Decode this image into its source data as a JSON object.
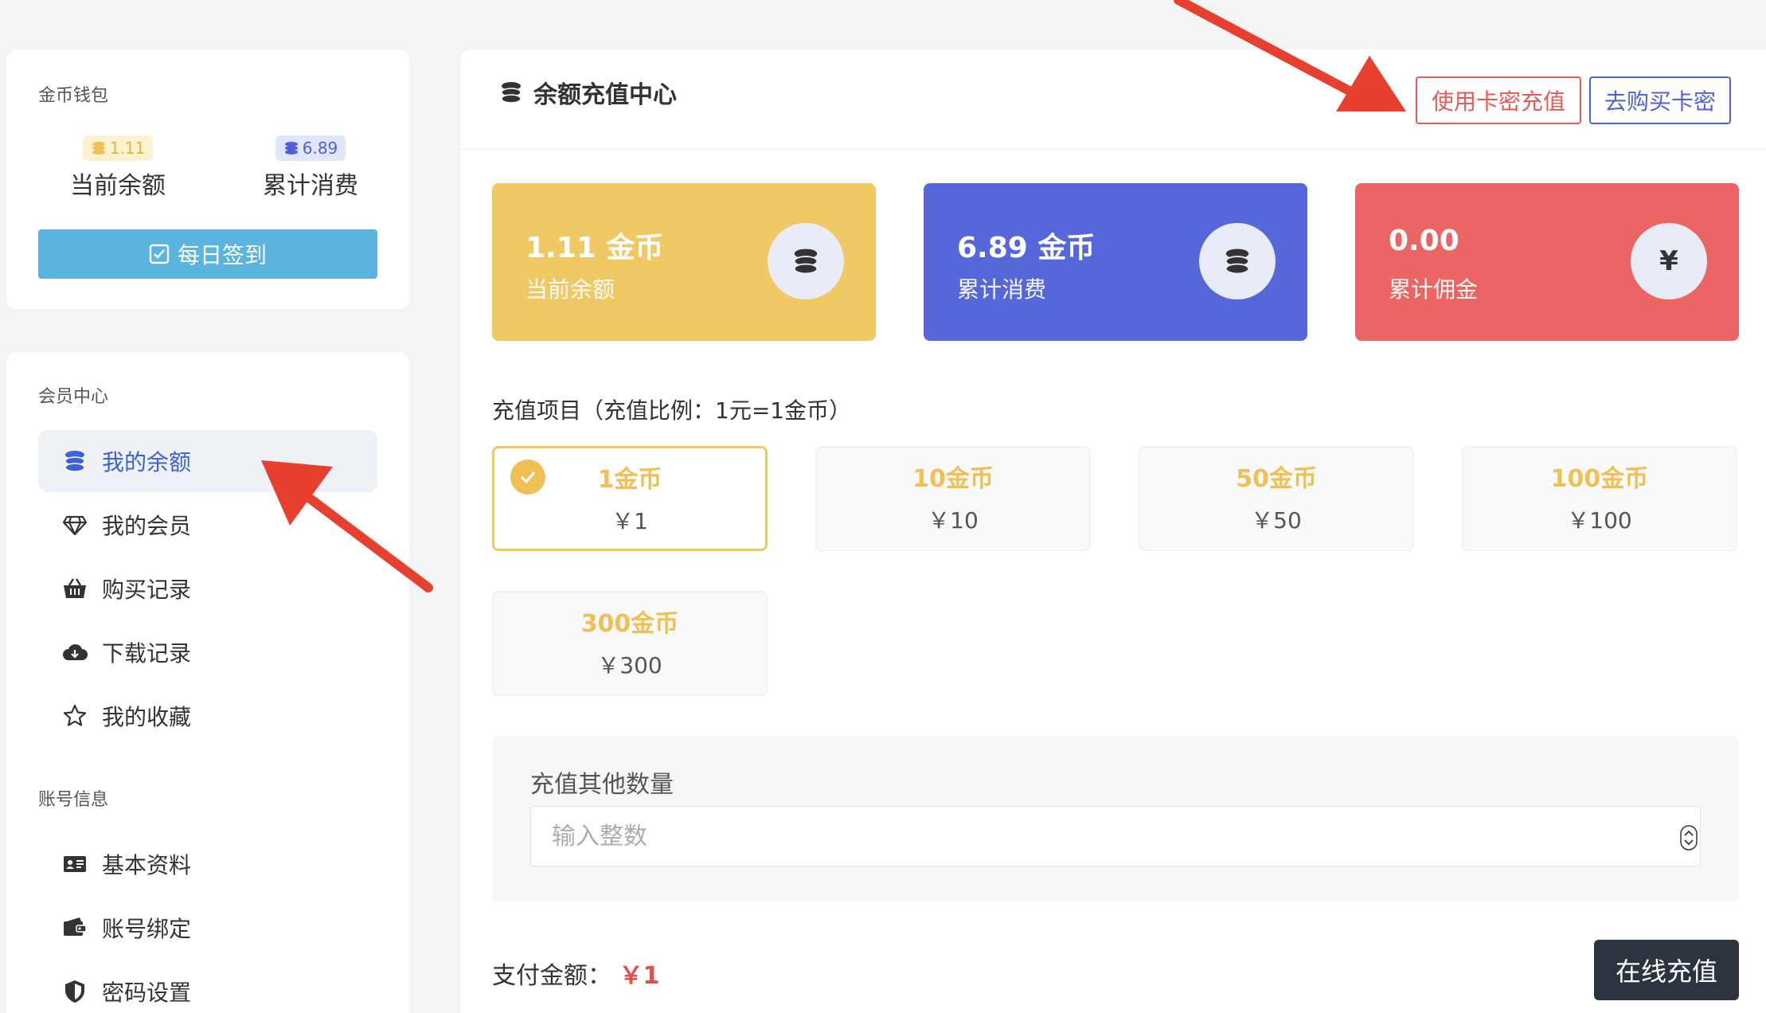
{
  "wallet": {
    "title": "金币钱包",
    "balance_value": "1.11",
    "balance_label": "当前余额",
    "spent_value": "6.89",
    "spent_label": "累计消费",
    "checkin_label": "每日签到"
  },
  "member_center": {
    "title": "会员中心",
    "items": [
      {
        "label": "我的余额",
        "icon": "coins-icon"
      },
      {
        "label": "我的会员",
        "icon": "diamond-icon"
      },
      {
        "label": "购买记录",
        "icon": "basket-icon"
      },
      {
        "label": "下载记录",
        "icon": "cloud-download-icon"
      },
      {
        "label": "我的收藏",
        "icon": "star-icon"
      }
    ]
  },
  "account_info": {
    "title": "账号信息",
    "items": [
      {
        "label": "基本资料",
        "icon": "id-card-icon"
      },
      {
        "label": "账号绑定",
        "icon": "wallet-bind-icon"
      },
      {
        "label": "密码设置",
        "icon": "shield-icon"
      }
    ]
  },
  "main": {
    "title": "余额充值中心",
    "use_card_label": "使用卡密充值",
    "buy_card_label": "去购买卡密",
    "stats": [
      {
        "value": "1.11 金币",
        "label": "当前余额",
        "icon": "coins-icon"
      },
      {
        "value": "6.89 金币",
        "label": "累计消费",
        "icon": "coins-icon"
      },
      {
        "value": "0.00",
        "label": "累计佣金",
        "icon_text": "¥"
      }
    ],
    "recharge_title": "充值项目（充值比例：1元=1金币）",
    "options": [
      {
        "coins": "1金币",
        "price": "￥1",
        "selected": true
      },
      {
        "coins": "10金币",
        "price": "￥10",
        "selected": false
      },
      {
        "coins": "50金币",
        "price": "￥50",
        "selected": false
      },
      {
        "coins": "100金币",
        "price": "￥100",
        "selected": false
      },
      {
        "coins": "300金币",
        "price": "￥300",
        "selected": false
      }
    ],
    "other_label": "充值其他数量",
    "other_placeholder": "输入整数",
    "pay_label": "支付金额：",
    "pay_amount": "￥1",
    "pay_button": "在线充值"
  },
  "colors": {
    "gold": "#f0c964",
    "blue": "#5668d9",
    "red": "#ea6563",
    "checkin": "#5bb4dd",
    "pay_button": "#2c3440",
    "annotation_arrow": "#e8402f"
  }
}
